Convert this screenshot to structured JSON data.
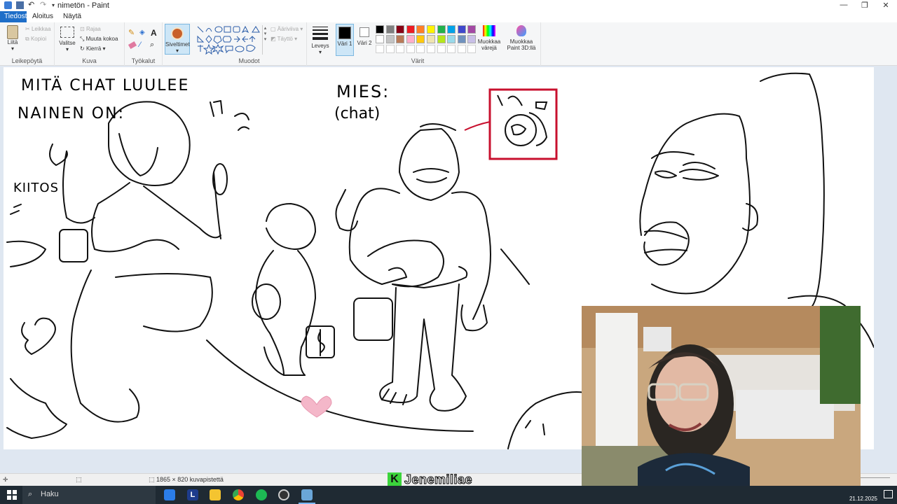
{
  "app": {
    "title": "nimetön - Paint",
    "tabs": [
      "Tiedosto",
      "Aloitus",
      "Näytä"
    ]
  },
  "ribbon": {
    "clipboard": {
      "label": "Leikepöytä",
      "paste": "Liitä",
      "cut": "Leikkaa",
      "copy": "Kopioi"
    },
    "image": {
      "label": "Kuva",
      "select": "Valitse",
      "crop": "Rajaa",
      "resize": "Muuta kokoa",
      "rotate": "Kierrä"
    },
    "tools": {
      "label": "Työkalut"
    },
    "brushes": {
      "label": "Siveltimet"
    },
    "shapes": {
      "label": "Muodot",
      "outline": "Ääriviiva",
      "fill": "Täyttö"
    },
    "size": {
      "label": "Leveys"
    },
    "colors": {
      "label": "Värit",
      "color1": "Väri 1",
      "color2": "Väri 2",
      "edit": "Muokkaa värejä",
      "paint3d": "Muokkaa Paint 3D:llä",
      "palette_row1": [
        "#000000",
        "#7f7f7f",
        "#880015",
        "#ed1c24",
        "#ff7f27",
        "#fff200",
        "#22b14c",
        "#00a2e8",
        "#3f48cc",
        "#a349a4"
      ],
      "palette_row2": [
        "#ffffff",
        "#c3c3c3",
        "#b97a57",
        "#ffaec9",
        "#ffc90e",
        "#efe4b0",
        "#b5e61d",
        "#99d9ea",
        "#7092be",
        "#c8bfe7"
      ]
    }
  },
  "drawing": {
    "text_left1": "MITÄ CHAT LUULEE",
    "text_left2": "NAINEN ON:",
    "text_kiitos": "KIITOS",
    "text_mies1": "MIES:",
    "text_mies2": "(chat)"
  },
  "status": {
    "dimensions": "1865 × 820 kuvapistettä"
  },
  "taskbar": {
    "search": "Haku",
    "date": "21.12.2025"
  },
  "stream": {
    "name": "Jenemiliae"
  }
}
